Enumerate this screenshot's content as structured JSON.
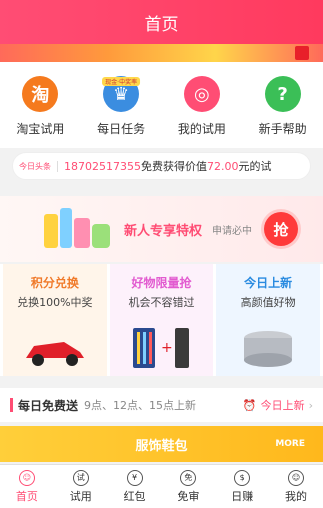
{
  "header": {
    "title": "首页"
  },
  "quick": [
    {
      "label": "淘宝试用",
      "icon": "taobao-icon",
      "glyph": "淘",
      "color": "#f57a1e"
    },
    {
      "label": "每日任务",
      "icon": "trophy-icon",
      "glyph": "♛",
      "color": "#3b8de0",
      "badge": "现金·中奖率"
    },
    {
      "label": "我的试用",
      "icon": "camera-icon",
      "glyph": "◎",
      "color": "#ff4d74"
    },
    {
      "label": "新手帮助",
      "icon": "help-icon",
      "glyph": "?",
      "color": "#3bbf57"
    }
  ],
  "ticker": {
    "tag": "今日头条",
    "phone": "18702517355",
    "text1": "免费获得价值",
    "price": "72.00",
    "text2": "元的试"
  },
  "promo": {
    "title": "新人专享特权",
    "sub": "申请必中",
    "button": "抢"
  },
  "cards": [
    {
      "title": "积分兑换",
      "sub": "兑换100%中奖",
      "color": "#f07a2a",
      "bg": "#fff5ea"
    },
    {
      "title": "好物限量抢",
      "sub": "机会不容错过",
      "color": "#e25bd0",
      "bg": "#fdf1fb"
    },
    {
      "title": "今日上新",
      "sub": "高颜值好物",
      "color": "#2a8be0",
      "bg": "#eef6ff"
    }
  ],
  "daily": {
    "title": "每日免费送",
    "sub": "9点、12点、15点上新",
    "right": "今日上新"
  },
  "category": {
    "title": "服饰鞋包",
    "more": "MORE"
  },
  "tabs": [
    {
      "label": "首页",
      "active": true,
      "glyph": "☺"
    },
    {
      "label": "试用",
      "glyph": "试"
    },
    {
      "label": "红包",
      "glyph": "¥"
    },
    {
      "label": "免审",
      "glyph": "免"
    },
    {
      "label": "日赚",
      "glyph": "$"
    },
    {
      "label": "我的",
      "glyph": "☺"
    }
  ]
}
